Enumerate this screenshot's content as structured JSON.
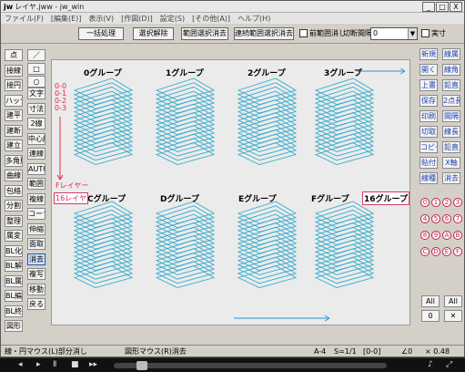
{
  "window": {
    "title": "レイヤ.jww - jw_win",
    "min": "_",
    "max": "□",
    "close": "X"
  },
  "menu": [
    "ファイル(F)",
    "[編集(E)]",
    "表示(V)",
    "[作図(D)]",
    "設定(S)",
    "[その他(A)]",
    "ヘルプ(H)"
  ],
  "toolbar": {
    "b1": "一括処理",
    "b2": "選択解除",
    "b3": "範囲選択消去",
    "b4": "連続範囲選択消去",
    "chk1": "前範囲消し",
    "cut_label": "切断間隔",
    "cut_value": "0",
    "chk2": "実寸"
  },
  "left_tools": {
    "col1": [
      "点",
      "接線",
      "接円",
      "ハッチ",
      "建平",
      "建断",
      "建立",
      "多角形",
      "曲線",
      "包絡",
      "分割",
      "整理",
      "属変",
      "BL化",
      "BL解",
      "BL属",
      "BL編",
      "BL終",
      "図形"
    ],
    "col2": [
      "文字",
      "寸法",
      "2線",
      "中心線",
      "連線",
      "AUTO",
      "範囲",
      "複線",
      "コーナー",
      "伸縮",
      "面取",
      "消去",
      "複写",
      "移動",
      "戻る"
    ]
  },
  "right_tools": {
    "col1": [
      "新規",
      "開く",
      "上書",
      "保存",
      "印刷",
      "切取",
      "コピー",
      "貼付",
      "線種"
    ],
    "col2": [
      "線属",
      "線角",
      "鉛直",
      "2点長",
      "間隔",
      "線長",
      "鉛直",
      "X軸",
      "消去"
    ]
  },
  "layers": {
    "nums": [
      "0",
      "1",
      "2",
      "3",
      "4",
      "5",
      "6",
      "7",
      "8",
      "9",
      "A",
      "B",
      "C",
      "D",
      "E",
      "F"
    ],
    "all": "All"
  },
  "drawing": {
    "groups_top": [
      "0グループ",
      "1グループ",
      "2グループ",
      "3グループ"
    ],
    "groups_bottom": [
      "Cグループ",
      "Dグループ",
      "Eグループ",
      "Fグループ"
    ],
    "box_label": "16グループ",
    "layer_labels": [
      "0-0",
      "0-1",
      "0-2",
      "0-3"
    ],
    "f_layer": "Fレイヤー",
    "box_layer": "16レイヤ",
    "colors": {
      "stroke": "#33aacc",
      "accent": "#e0284f",
      "arrow": "#2e96d6"
    }
  },
  "status": {
    "left": "線・円マウス(L)部分消し",
    "mid": "図形マウス(R)消去",
    "paper": "A-4",
    "scale": "S=1/1",
    "layer": "[0-0]",
    "angle": "∠0",
    "zoom": "× 0.48"
  }
}
